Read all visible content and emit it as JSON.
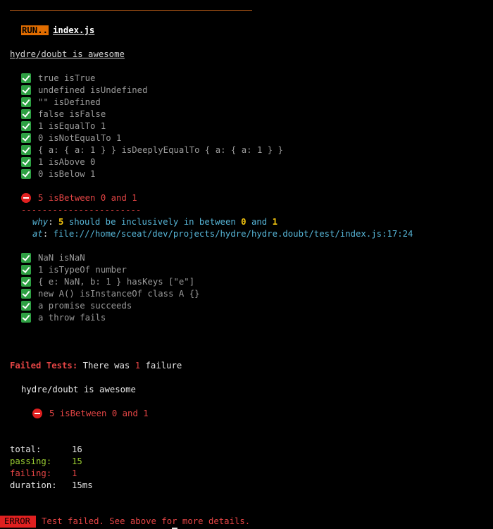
{
  "header": {
    "run_badge": "RUN..",
    "file_name": "index.js"
  },
  "suite": {
    "title": "hydre/doubt is awesome"
  },
  "tests_before": [
    {
      "text": "true isTrue"
    },
    {
      "text": "undefined isUndefined"
    },
    {
      "text": "\"\" isDefined"
    },
    {
      "text": "false isFalse"
    },
    {
      "text": "1 isEqualTo 1"
    },
    {
      "text": "0 isNotEqualTo 1"
    },
    {
      "text": "{ a: { a: 1 } } isDeeplyEqualTo { a: { a: 1 } }"
    },
    {
      "text": "1 isAbove 0"
    },
    {
      "text": "0 isBelow 1"
    }
  ],
  "failure": {
    "text": "5 isBetween 0 and 1",
    "dash_rule": "-----------------------",
    "why_label": "why",
    "why_value": "5",
    "why_mid": "should be inclusively in between",
    "why_low": "0",
    "why_and": "and",
    "why_high": "1",
    "at_label": "at",
    "at_value": "file:///home/sceat/dev/projects/hydre/hydre.doubt/test/index.js:17:24"
  },
  "tests_after": [
    {
      "text": "NaN isNaN"
    },
    {
      "text": "1 isTypeOf number"
    },
    {
      "text": "{ e: NaN, b: 1 } hasKeys [\"e\"]"
    },
    {
      "text": "new A() isInstanceOf class A {}"
    },
    {
      "text": "a promise succeeds"
    },
    {
      "text": "a throw fails"
    }
  ],
  "summary": {
    "failed_label": "Failed Tests:",
    "was_prefix": "There was",
    "fail_count": "1",
    "was_suffix": "failure",
    "suite_title": "hydre/doubt is awesome",
    "failed_test": "5 isBetween 0 and 1"
  },
  "stats": {
    "total_label": "total:",
    "total_value": "16",
    "passing_label": "passing:",
    "passing_value": "15",
    "failing_label": "failing:",
    "failing_value": "1",
    "duration_label": "duration:",
    "duration_value": "15ms"
  },
  "error_bar": {
    "badge": "ERROR",
    "message_before": "Test failed. See above fo",
    "message_cursor": "r",
    "message_after": " more details."
  },
  "colors": {
    "background": "#000000",
    "run_badge": "#e06c00",
    "pass_icon": "#2ea043",
    "fail": "#e54545",
    "cyan": "#57b6d8",
    "yellow": "#f2c40f",
    "passing_green": "#9acd32"
  }
}
